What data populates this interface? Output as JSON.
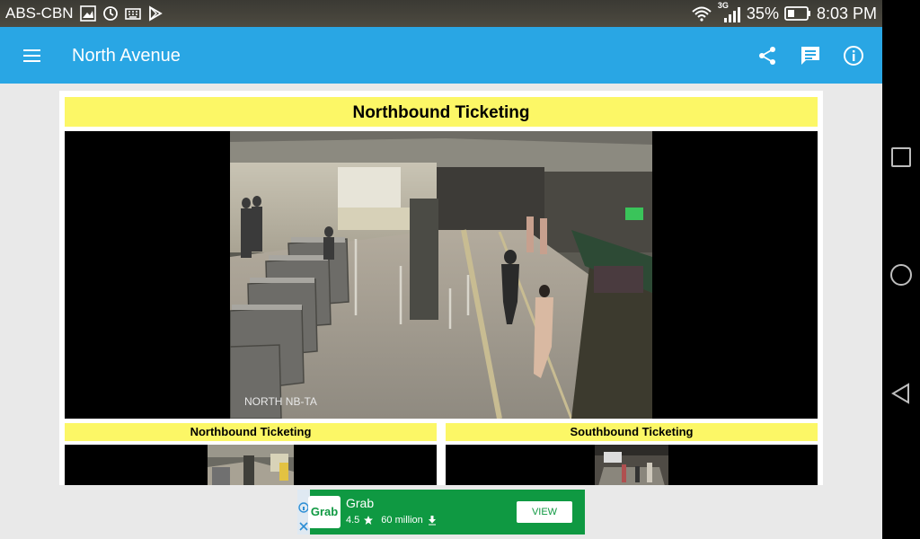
{
  "status_bar": {
    "carrier": "ABS-CBN",
    "network_type": "3G",
    "battery": "35%",
    "time": "8:03 PM",
    "icons": [
      "gallery-icon",
      "sync-icon",
      "keyboard-icon",
      "play-store-icon",
      "wifi-icon",
      "signal-icon",
      "battery-icon"
    ]
  },
  "app_bar": {
    "title": "North Avenue",
    "actions": [
      "share-icon",
      "comment-icon",
      "info-icon"
    ]
  },
  "main_camera": {
    "title": "Northbound Ticketing",
    "overlay_label": "NORTH NB-TA"
  },
  "thumbnails": [
    {
      "title": "Northbound Ticketing"
    },
    {
      "title": "Southbound Ticketing"
    }
  ],
  "ad": {
    "brand": "Grab",
    "logo_text": "Grab",
    "rating": "4.5",
    "installs": "60 million",
    "cta": "VIEW"
  },
  "colors": {
    "app_bar": "#29a6e4",
    "title_strip": "#fcf766",
    "ad_green": "#0f9942"
  }
}
